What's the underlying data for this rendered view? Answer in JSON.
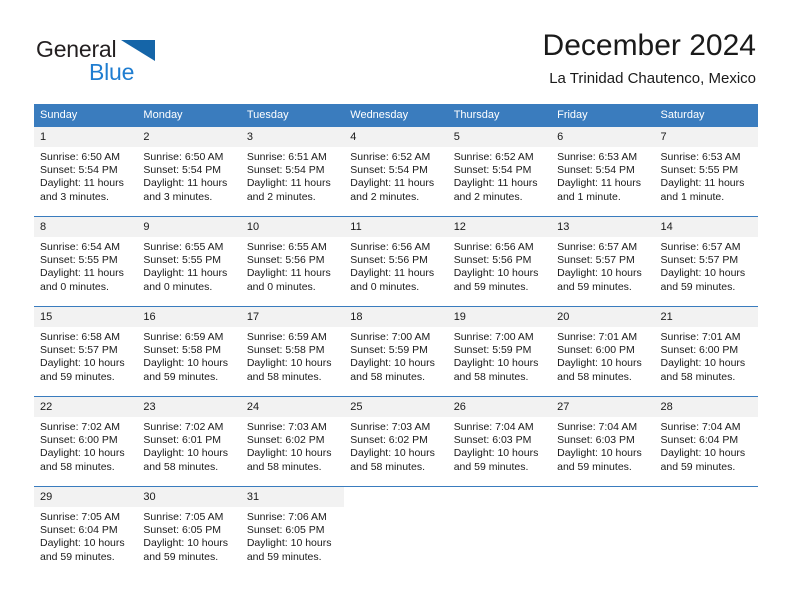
{
  "brand": {
    "name_dark": "General",
    "name_blue": "Blue",
    "accent_dark": "#1565a8",
    "accent_blue": "#1f7dd0"
  },
  "header": {
    "title": "December 2024",
    "subtitle": "La Trinidad Chautenco, Mexico"
  },
  "calendar": {
    "header_bg": "#3a7cbe",
    "daynum_bg": "#f2f2f2",
    "weekday_labels": [
      "Sunday",
      "Monday",
      "Tuesday",
      "Wednesday",
      "Thursday",
      "Friday",
      "Saturday"
    ],
    "weeks": [
      [
        {
          "day": "1",
          "sunrise": "Sunrise: 6:50 AM",
          "sunset": "Sunset: 5:54 PM",
          "daylight_1": "Daylight: 11 hours",
          "daylight_2": "and 3 minutes."
        },
        {
          "day": "2",
          "sunrise": "Sunrise: 6:50 AM",
          "sunset": "Sunset: 5:54 PM",
          "daylight_1": "Daylight: 11 hours",
          "daylight_2": "and 3 minutes."
        },
        {
          "day": "3",
          "sunrise": "Sunrise: 6:51 AM",
          "sunset": "Sunset: 5:54 PM",
          "daylight_1": "Daylight: 11 hours",
          "daylight_2": "and 2 minutes."
        },
        {
          "day": "4",
          "sunrise": "Sunrise: 6:52 AM",
          "sunset": "Sunset: 5:54 PM",
          "daylight_1": "Daylight: 11 hours",
          "daylight_2": "and 2 minutes."
        },
        {
          "day": "5",
          "sunrise": "Sunrise: 6:52 AM",
          "sunset": "Sunset: 5:54 PM",
          "daylight_1": "Daylight: 11 hours",
          "daylight_2": "and 2 minutes."
        },
        {
          "day": "6",
          "sunrise": "Sunrise: 6:53 AM",
          "sunset": "Sunset: 5:54 PM",
          "daylight_1": "Daylight: 11 hours",
          "daylight_2": "and 1 minute."
        },
        {
          "day": "7",
          "sunrise": "Sunrise: 6:53 AM",
          "sunset": "Sunset: 5:55 PM",
          "daylight_1": "Daylight: 11 hours",
          "daylight_2": "and 1 minute."
        }
      ],
      [
        {
          "day": "8",
          "sunrise": "Sunrise: 6:54 AM",
          "sunset": "Sunset: 5:55 PM",
          "daylight_1": "Daylight: 11 hours",
          "daylight_2": "and 0 minutes."
        },
        {
          "day": "9",
          "sunrise": "Sunrise: 6:55 AM",
          "sunset": "Sunset: 5:55 PM",
          "daylight_1": "Daylight: 11 hours",
          "daylight_2": "and 0 minutes."
        },
        {
          "day": "10",
          "sunrise": "Sunrise: 6:55 AM",
          "sunset": "Sunset: 5:56 PM",
          "daylight_1": "Daylight: 11 hours",
          "daylight_2": "and 0 minutes."
        },
        {
          "day": "11",
          "sunrise": "Sunrise: 6:56 AM",
          "sunset": "Sunset: 5:56 PM",
          "daylight_1": "Daylight: 11 hours",
          "daylight_2": "and 0 minutes."
        },
        {
          "day": "12",
          "sunrise": "Sunrise: 6:56 AM",
          "sunset": "Sunset: 5:56 PM",
          "daylight_1": "Daylight: 10 hours",
          "daylight_2": "and 59 minutes."
        },
        {
          "day": "13",
          "sunrise": "Sunrise: 6:57 AM",
          "sunset": "Sunset: 5:57 PM",
          "daylight_1": "Daylight: 10 hours",
          "daylight_2": "and 59 minutes."
        },
        {
          "day": "14",
          "sunrise": "Sunrise: 6:57 AM",
          "sunset": "Sunset: 5:57 PM",
          "daylight_1": "Daylight: 10 hours",
          "daylight_2": "and 59 minutes."
        }
      ],
      [
        {
          "day": "15",
          "sunrise": "Sunrise: 6:58 AM",
          "sunset": "Sunset: 5:57 PM",
          "daylight_1": "Daylight: 10 hours",
          "daylight_2": "and 59 minutes."
        },
        {
          "day": "16",
          "sunrise": "Sunrise: 6:59 AM",
          "sunset": "Sunset: 5:58 PM",
          "daylight_1": "Daylight: 10 hours",
          "daylight_2": "and 59 minutes."
        },
        {
          "day": "17",
          "sunrise": "Sunrise: 6:59 AM",
          "sunset": "Sunset: 5:58 PM",
          "daylight_1": "Daylight: 10 hours",
          "daylight_2": "and 58 minutes."
        },
        {
          "day": "18",
          "sunrise": "Sunrise: 7:00 AM",
          "sunset": "Sunset: 5:59 PM",
          "daylight_1": "Daylight: 10 hours",
          "daylight_2": "and 58 minutes."
        },
        {
          "day": "19",
          "sunrise": "Sunrise: 7:00 AM",
          "sunset": "Sunset: 5:59 PM",
          "daylight_1": "Daylight: 10 hours",
          "daylight_2": "and 58 minutes."
        },
        {
          "day": "20",
          "sunrise": "Sunrise: 7:01 AM",
          "sunset": "Sunset: 6:00 PM",
          "daylight_1": "Daylight: 10 hours",
          "daylight_2": "and 58 minutes."
        },
        {
          "day": "21",
          "sunrise": "Sunrise: 7:01 AM",
          "sunset": "Sunset: 6:00 PM",
          "daylight_1": "Daylight: 10 hours",
          "daylight_2": "and 58 minutes."
        }
      ],
      [
        {
          "day": "22",
          "sunrise": "Sunrise: 7:02 AM",
          "sunset": "Sunset: 6:00 PM",
          "daylight_1": "Daylight: 10 hours",
          "daylight_2": "and 58 minutes."
        },
        {
          "day": "23",
          "sunrise": "Sunrise: 7:02 AM",
          "sunset": "Sunset: 6:01 PM",
          "daylight_1": "Daylight: 10 hours",
          "daylight_2": "and 58 minutes."
        },
        {
          "day": "24",
          "sunrise": "Sunrise: 7:03 AM",
          "sunset": "Sunset: 6:02 PM",
          "daylight_1": "Daylight: 10 hours",
          "daylight_2": "and 58 minutes."
        },
        {
          "day": "25",
          "sunrise": "Sunrise: 7:03 AM",
          "sunset": "Sunset: 6:02 PM",
          "daylight_1": "Daylight: 10 hours",
          "daylight_2": "and 58 minutes."
        },
        {
          "day": "26",
          "sunrise": "Sunrise: 7:04 AM",
          "sunset": "Sunset: 6:03 PM",
          "daylight_1": "Daylight: 10 hours",
          "daylight_2": "and 59 minutes."
        },
        {
          "day": "27",
          "sunrise": "Sunrise: 7:04 AM",
          "sunset": "Sunset: 6:03 PM",
          "daylight_1": "Daylight: 10 hours",
          "daylight_2": "and 59 minutes."
        },
        {
          "day": "28",
          "sunrise": "Sunrise: 7:04 AM",
          "sunset": "Sunset: 6:04 PM",
          "daylight_1": "Daylight: 10 hours",
          "daylight_2": "and 59 minutes."
        }
      ],
      [
        {
          "day": "29",
          "sunrise": "Sunrise: 7:05 AM",
          "sunset": "Sunset: 6:04 PM",
          "daylight_1": "Daylight: 10 hours",
          "daylight_2": "and 59 minutes."
        },
        {
          "day": "30",
          "sunrise": "Sunrise: 7:05 AM",
          "sunset": "Sunset: 6:05 PM",
          "daylight_1": "Daylight: 10 hours",
          "daylight_2": "and 59 minutes."
        },
        {
          "day": "31",
          "sunrise": "Sunrise: 7:06 AM",
          "sunset": "Sunset: 6:05 PM",
          "daylight_1": "Daylight: 10 hours",
          "daylight_2": "and 59 minutes."
        },
        {
          "day": "",
          "sunrise": "",
          "sunset": "",
          "daylight_1": "",
          "daylight_2": ""
        },
        {
          "day": "",
          "sunrise": "",
          "sunset": "",
          "daylight_1": "",
          "daylight_2": ""
        },
        {
          "day": "",
          "sunrise": "",
          "sunset": "",
          "daylight_1": "",
          "daylight_2": ""
        },
        {
          "day": "",
          "sunrise": "",
          "sunset": "",
          "daylight_1": "",
          "daylight_2": ""
        }
      ]
    ]
  }
}
